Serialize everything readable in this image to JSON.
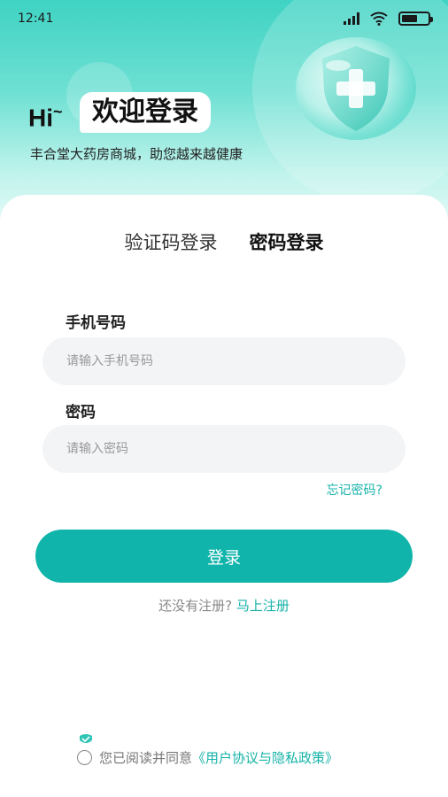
{
  "status_bar": {
    "time": "12:41"
  },
  "header": {
    "hi": "Hi",
    "hi_mark": "~",
    "welcome": "欢迎登录",
    "subtitle": "丰合堂大药房商城，助您越来越健康"
  },
  "tabs": [
    {
      "label": "验证码登录",
      "active": false
    },
    {
      "label": "密码登录",
      "active": true
    }
  ],
  "form": {
    "phone_label": "手机号码",
    "phone_placeholder": "请输入手机号码",
    "password_label": "密码",
    "password_placeholder": "请输入密码",
    "forgot": "忘记密码?",
    "login_button": "登录"
  },
  "register": {
    "prompt": "还没有注册?",
    "link": "马上注册"
  },
  "agreement": {
    "text": "您已阅读并同意",
    "policy": "《用户协议与隐私政策》"
  },
  "colors": {
    "accent": "#10b4ab",
    "link": "#16b3a8"
  }
}
